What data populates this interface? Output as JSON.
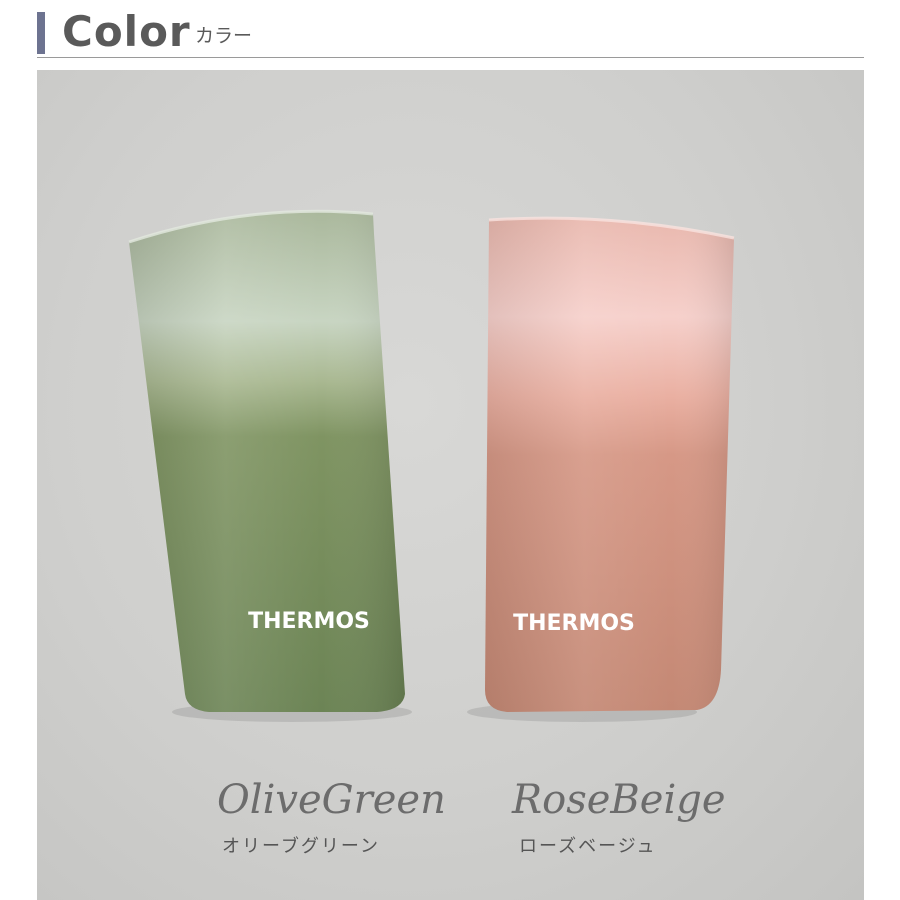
{
  "header": {
    "title": "Color",
    "subtitle": "カラー",
    "accent_color": "#6d7390"
  },
  "products": [
    {
      "brand": "THERMOS",
      "script_name": "OliveGreen",
      "kana_name": "オリーブグリーン",
      "top_color": "#cfd9cb",
      "bottom_color": "#6f8758"
    },
    {
      "brand": "THERMOS",
      "script_name": "RoseBeige",
      "kana_name": "ローズベージュ",
      "top_color": "#f4cfca",
      "bottom_color": "#c88a78"
    }
  ]
}
